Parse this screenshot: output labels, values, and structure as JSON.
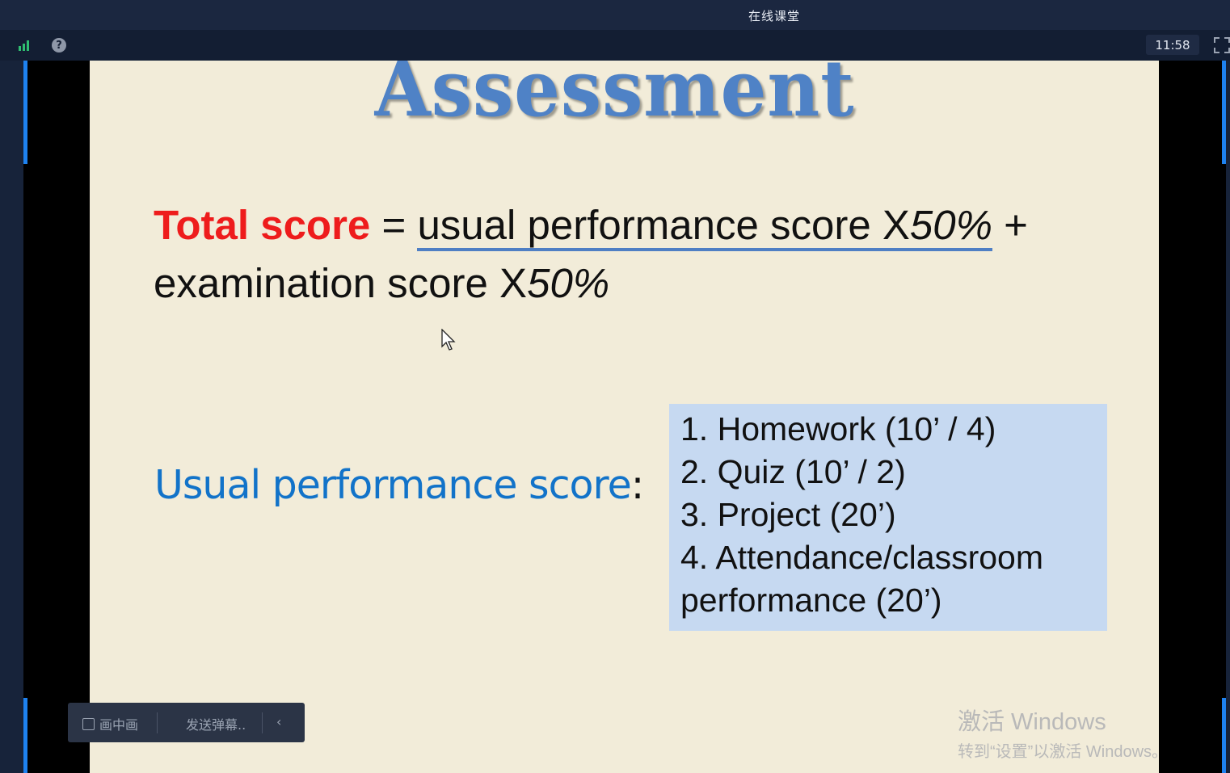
{
  "window": {
    "title": "在线课堂"
  },
  "toolbar": {
    "clock": "11:58"
  },
  "slide": {
    "title": "Assessment",
    "formula": {
      "total_label": "Total score",
      "equals": " = ",
      "part1": "usual performance score X",
      "part1_pct": "50%",
      "plus": " +",
      "part2": "examination score X",
      "part2_pct": "50%"
    },
    "usual_label": "Usual performance score",
    "usual_colon": ":",
    "score_items": [
      "1. Homework    (10’ / 4)",
      "2. Quiz             (10’ / 2)",
      "3. Project          (20’)",
      "4. Attendance/classroom",
      "performance    (20’)"
    ]
  },
  "watermark": {
    "line1": "激活 Windows",
    "line2": "转到“设置”以激活 Windows。"
  },
  "controls": {
    "pip_label": "画中画",
    "danmaku_label": "发送弹幕..",
    "collapse_label": "‹"
  },
  "colors": {
    "accent_edge": "#1e82f0",
    "title_blue": "#4f82c6",
    "red": "#ee1c1c",
    "box_bg": "#c6d9f1"
  }
}
